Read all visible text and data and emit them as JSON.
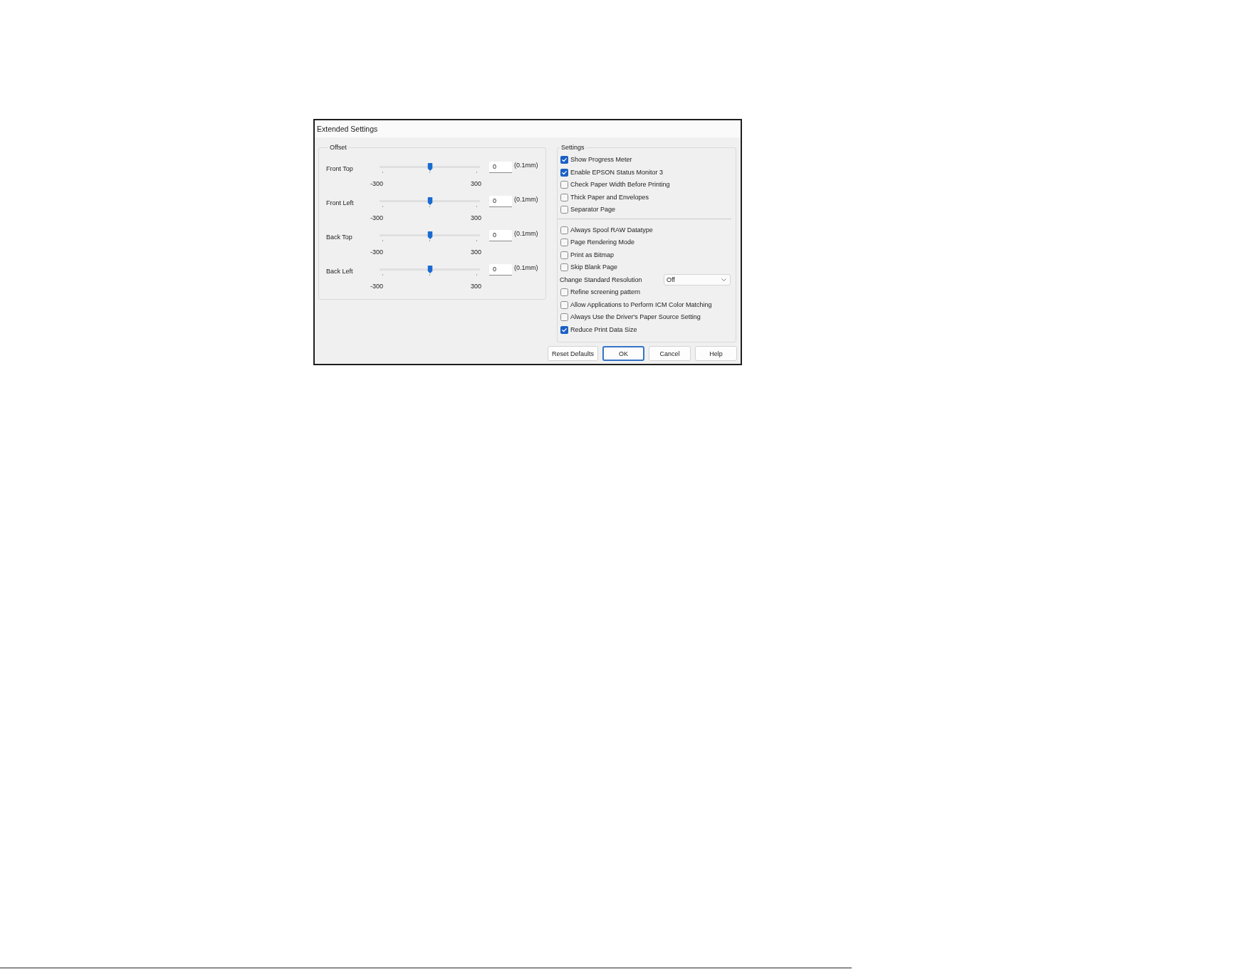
{
  "window": {
    "title": "Extended Settings"
  },
  "offset": {
    "title": "Offset",
    "sliders": [
      {
        "label": "Front Top",
        "level": 0.5,
        "min_label": "-300",
        "max_label": "300",
        "value": "0",
        "unit": "(0.1mm)"
      },
      {
        "label": "Front Left",
        "level": 0.5,
        "min_label": "-300",
        "max_label": "300",
        "value": "0",
        "unit": "(0.1mm)"
      },
      {
        "label": "Back Top",
        "level": 0.5,
        "min_label": "-300",
        "max_label": "300",
        "value": "0",
        "unit": "(0.1mm)"
      },
      {
        "label": "Back Left",
        "level": 0.5,
        "min_label": "-300",
        "max_label": "300",
        "value": "0",
        "unit": "(0.1mm)"
      }
    ]
  },
  "settings": {
    "title": "Settings",
    "sections": [
      {
        "items": [
          {
            "kind": "checkbox",
            "label": "Show Progress Meter",
            "checked": true
          },
          {
            "kind": "checkbox",
            "label": "Enable EPSON Status Monitor 3",
            "checked": true
          },
          {
            "kind": "checkbox",
            "label": "Check Paper Width Before Printing",
            "checked": false
          },
          {
            "kind": "checkbox",
            "label": "Thick Paper and Envelopes",
            "checked": false
          },
          {
            "kind": "checkbox",
            "label": "Separator Page",
            "checked": false
          }
        ]
      },
      {
        "items": [
          {
            "kind": "checkbox",
            "label": "Always Spool RAW Datatype",
            "checked": false
          },
          {
            "kind": "checkbox",
            "label": "Page Rendering Mode",
            "checked": false
          },
          {
            "kind": "checkbox",
            "label": "Print as Bitmap",
            "checked": false
          },
          {
            "kind": "checkbox",
            "label": "Skip Blank Page",
            "checked": false
          },
          {
            "kind": "dropdown",
            "label": "Change Standard Resolution",
            "value": "Off"
          },
          {
            "kind": "checkbox",
            "label": "Refine screening pattern",
            "checked": false
          },
          {
            "kind": "checkbox",
            "label": "Allow Applications to Perform ICM Color Matching",
            "checked": false
          },
          {
            "kind": "checkbox",
            "label": "Always Use the Driver's Paper Source Setting",
            "checked": false
          },
          {
            "kind": "checkbox",
            "label": "Reduce Print Data Size",
            "checked": true
          }
        ]
      }
    ]
  },
  "buttons": [
    {
      "label": "Reset Defaults",
      "focused": false
    },
    {
      "label": "OK",
      "focused": true
    },
    {
      "label": "Cancel",
      "focused": false
    },
    {
      "label": "Help",
      "focused": false
    }
  ]
}
